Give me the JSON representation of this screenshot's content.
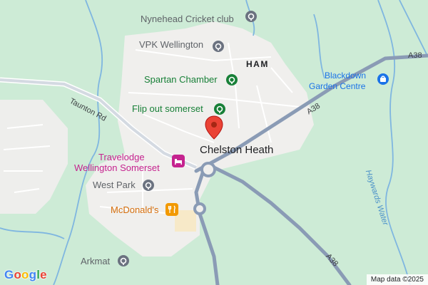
{
  "map": {
    "places": {
      "chelston_heath": "Chelston Heath",
      "ham": "HAM"
    },
    "roads": {
      "taunton_rd": "Taunton Rd",
      "a38_top": "A38",
      "a38_mid": "A38",
      "a38_bottom": "A38"
    },
    "water": {
      "haywards_water": "Haywards Water"
    },
    "pois": {
      "nynehead_cricket": "Nynehead Cricket club",
      "vpk_wellington": "VPK Wellington",
      "spartan_chamber": "Spartan Chamber",
      "flip_out": "Flip out somerset",
      "blackdown_line1": "Blackdown",
      "blackdown_line2": "Garden Centre",
      "travelodge_line1": "Travelodge",
      "travelodge_line2": "Wellington Somerset",
      "west_park": "West Park",
      "mcdonalds": "McDonald's",
      "arkmat": "Arkmat"
    },
    "colors": {
      "land": "#cdebd6",
      "urban": "#f0efed",
      "highway": "#8a9bb5",
      "water": "#7fb6e0",
      "marker": "#ea4335"
    },
    "icons": {
      "gray_poi": "pin-circle-icon",
      "green_poi": "leisure-pin-icon",
      "shop": "shopping-bag-icon",
      "hotel": "bed-icon",
      "food": "fork-knife-icon",
      "marker": "red-location-marker-icon"
    }
  },
  "footer": {
    "logo": "Google",
    "credit": "Map data ©2025"
  }
}
